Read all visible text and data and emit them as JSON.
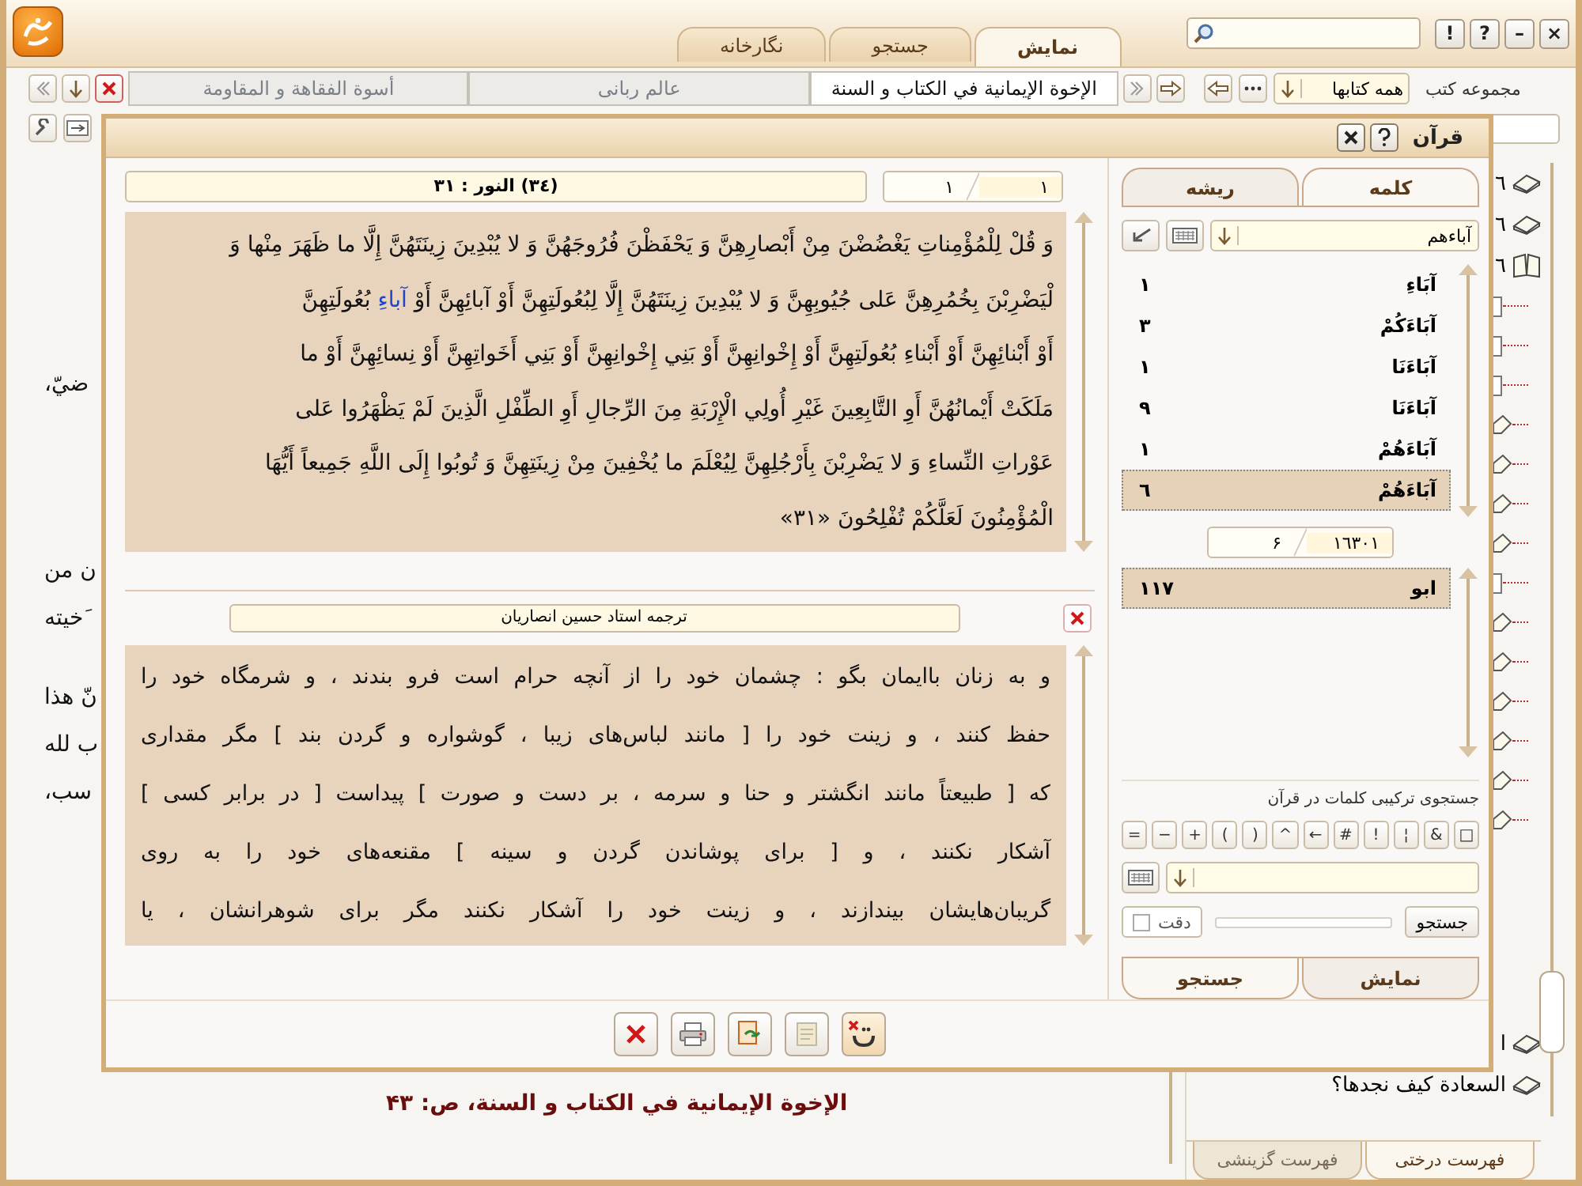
{
  "top_tabs": [
    {
      "label": "نمایش",
      "selected": true
    },
    {
      "label": "جستجو",
      "selected": false
    },
    {
      "label": "نگارخانه",
      "selected": false
    }
  ],
  "window_buttons": [
    "×",
    "–",
    "?",
    "!"
  ],
  "doc_tabs": [
    {
      "label": "الإخوة الإيمانية في الكتاب و السنة",
      "selected": true
    },
    {
      "label": "عالم ربانی",
      "selected": false
    },
    {
      "label": "أسوة الفقاهة و المقاومة",
      "selected": false
    }
  ],
  "collection": {
    "label": "مجموعه کتب",
    "value": "همه کتابها"
  },
  "background_text": [
    "ضيّ،",
    "ن من",
    "َخيته",
    "نّ هذا",
    "ب لله",
    "سب،"
  ],
  "page_title": "الإخوة الإيمانية في الكتاب و السنة، ص: ۴۳",
  "tree": {
    "items": [
      {
        "kind": "book",
        "text": "٦"
      },
      {
        "kind": "book",
        "text": "٦"
      },
      {
        "kind": "open-book",
        "text": "٦",
        "children": [
          {
            "kind": "page"
          },
          {
            "kind": "page"
          },
          {
            "kind": "page"
          },
          {
            "kind": "section"
          },
          {
            "kind": "section"
          },
          {
            "kind": "section"
          },
          {
            "kind": "section"
          },
          {
            "kind": "page"
          },
          {
            "kind": "section"
          },
          {
            "kind": "section"
          },
          {
            "kind": "section"
          },
          {
            "kind": "section"
          },
          {
            "kind": "section"
          },
          {
            "kind": "section"
          }
        ]
      },
      {
        "kind": "book",
        "text": "ا"
      },
      {
        "kind": "book",
        "text": "السعادة كيف نجدها؟"
      }
    ],
    "tabs": [
      {
        "label": "فهرست درختی",
        "selected": true
      },
      {
        "label": "فهرست گزینشی",
        "selected": false
      }
    ]
  },
  "dialog": {
    "title": "قرآن",
    "verse_ref": "(٣٤) النور : ٣١",
    "pager": {
      "current": "١",
      "total": "١"
    },
    "verse_lines": [
      [
        {
          "text": "وَ قُلْ لِلْمُؤْمِناتِ يَغْضُضْنَ مِنْ أَبْصارِهِنَّ وَ يَحْفَظْنَ فُرُوجَهُنَّ وَ لا يُبْدِينَ زِينَتَهُنَّ إِلَّا ما ظَهَرَ مِنْها وَ",
          "highlighted": false
        }
      ],
      [
        {
          "text": "لْيَضْرِبْنَ بِخُمُرِهِنَّ عَلى جُيُوبِهِنَّ وَ لا يُبْدِينَ زِينَتَهُنَّ إِلَّا لِبُعُولَتِهِنَّ أَوْ آبائِهِنَّ أَوْ ",
          "highlighted": false
        },
        {
          "text": "آباءِ",
          "highlighted": true
        },
        {
          "text": " بُعُولَتِهِنَّ",
          "highlighted": false
        }
      ],
      [
        {
          "text": "أَوْ أَبْنائِهِنَّ أَوْ أَبْناءِ بُعُولَتِهِنَّ أَوْ إِخْوانِهِنَّ أَوْ بَنِي إِخْوانِهِنَّ أَوْ بَنِي أَخَواتِهِنَّ أَوْ نِسائِهِنَّ أَوْ ما",
          "highlighted": false
        }
      ],
      [
        {
          "text": "مَلَكَتْ أَيْمانُهُنَّ أَوِ التَّابِعِينَ غَيْرِ أُولِي الْإِرْبَةِ مِنَ الرِّجالِ أَوِ الطِّفْلِ الَّذِينَ لَمْ يَظْهَرُوا عَلى",
          "highlighted": false
        }
      ],
      [
        {
          "text": "عَوْراتِ النِّساءِ وَ لا يَضْرِبْنَ بِأَرْجُلِهِنَّ لِيُعْلَمَ ما يُخْفِينَ مِنْ زِينَتِهِنَّ وَ تُوبُوا إِلَى اللَّهِ جَمِيعاً أَيُّهَا",
          "highlighted": false
        }
      ],
      [
        {
          "text": "الْمُؤْمِنُونَ لَعَلَّكُمْ تُفْلِحُونَ «٣١»",
          "highlighted": false
        }
      ]
    ],
    "translation_title": "ترجمه استاد حسین انصاریان",
    "translation_lines": [
      "و به زنان باایمان بگو : چشمان خود را از آنچه حرام است فرو بندند ، و شرمگاه خود را",
      "حفظ کنند ، و زینت خود را [ مانند لباس‌های زیبا ، گوشواره و گردن بند ] مگر مقداری",
      "که [ طبیعتاً مانند انگشتر و حنا و سرمه ، بر دست و صورت ] پیداست [ در برابر کسی ]",
      "آشکار نکنند ، و [ برای پوشاندن گردن و سینه ] مقنعه‌های خود را به روی",
      "گریبان‌هایشان بیندازند ، و زینت خود را آشکار نکنند مگر برای شوهرانشان ، یا"
    ],
    "word_tabs": [
      {
        "label": "کلمه",
        "selected": true
      },
      {
        "label": "ریشه",
        "selected": false
      }
    ],
    "word_query": "آباءهم",
    "words": [
      {
        "word": "آبَاءِ",
        "count": "١",
        "selected": false
      },
      {
        "word": "آبَاءَكُمْ",
        "count": "٣",
        "selected": false
      },
      {
        "word": "آبَاءَنَا",
        "count": "١",
        "selected": false
      },
      {
        "word": "آبَاءَنَا",
        "count": "٩",
        "selected": false
      },
      {
        "word": "آبَاءَهُمْ",
        "count": "١",
        "selected": false
      },
      {
        "word": "آبَاءَهُمْ",
        "count": "٦",
        "selected": true
      }
    ],
    "word_counter": {
      "total": "١٦٣٠١",
      "found": "۶"
    },
    "roots": [
      {
        "root": "ابو",
        "count": "١١٧",
        "selected": true
      }
    ],
    "combo_label": "جستجوی ترکیبی کلمات در قرآن",
    "operators": [
      "□",
      "&",
      "¦",
      "!",
      "#",
      "←",
      "^",
      ")",
      "(",
      "+",
      "−",
      "="
    ],
    "search_button": "جستجو",
    "progress": {
      "level": 0
    },
    "exact": {
      "label": "دقت",
      "checked": false
    },
    "bottom_tabs": [
      {
        "label": "نمایش",
        "selected": false
      },
      {
        "label": "جستجو",
        "selected": true
      }
    ]
  }
}
